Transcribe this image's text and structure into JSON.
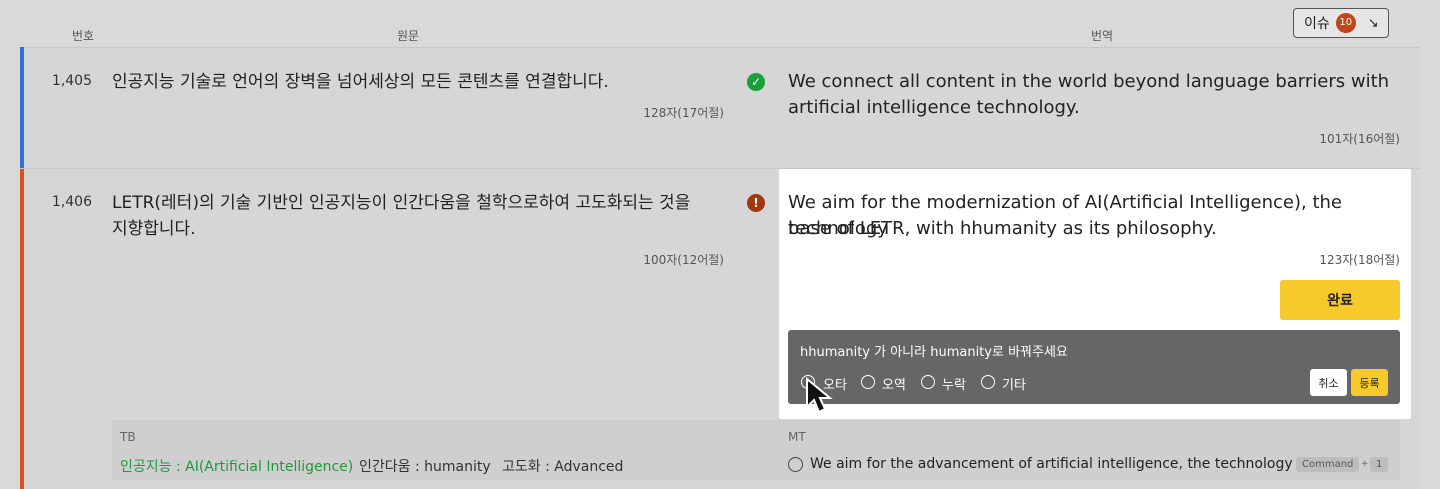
{
  "columns": {
    "number": "번호",
    "source": "원문",
    "translation": "번역"
  },
  "issue_button": {
    "label": "이슈",
    "count": "10",
    "arrow": "↘"
  },
  "segments": [
    {
      "number": "1,405",
      "source": "인공지능 기술로 언어의 장벽을 넘어세상의 모든 콘텐츠를 연결합니다.",
      "source_count": "128자(17어절)",
      "translation_line1": "We connect all content in the world beyond language barriers with",
      "translation_line2": "artificial intelligence technology.",
      "translation_count": "101자(16어절)",
      "status": "complete"
    },
    {
      "number": "1,406",
      "source_line1": "LETR(레터)의 기술 기반인 인공지능이 인간다움을 철학으로하여 고도화되는 것을",
      "source_line2": "지향합니다.",
      "source_count": "100자(12어절)",
      "translation_line1": "We aim for the modernization of AI(Artificial Intelligence), the technology",
      "translation_line2": "base of LETR, with hhumanity as its philosophy.",
      "translation_count": "123자(18어절)",
      "status": "issue"
    }
  ],
  "editor": {
    "done_label": "완료",
    "comment": {
      "text": "hhumanity 가 아니라 humanity로 바꿔주세요",
      "types": [
        "오타",
        "오역",
        "누락",
        "기타"
      ],
      "selected_type": "오타",
      "cancel_label": "취소",
      "submit_label": "등록"
    }
  },
  "tb": {
    "label": "TB",
    "terms": [
      "인공지능 : AI(Artificial Intelligence)",
      "인간다움 : humanity",
      "고도화 : Advanced"
    ]
  },
  "mt": {
    "label": "MT",
    "suggestion": "We aim for the advancement of artificial intelligence, the technology base",
    "shortcut_key": "Command",
    "shortcut_plus": "+",
    "shortcut_num": "1"
  },
  "colors": {
    "accent": "#f8c92a",
    "complete": "#1a9f3c",
    "issue": "#a0390f",
    "row_active": "#d4551c",
    "row_done": "#2f6fd6"
  }
}
